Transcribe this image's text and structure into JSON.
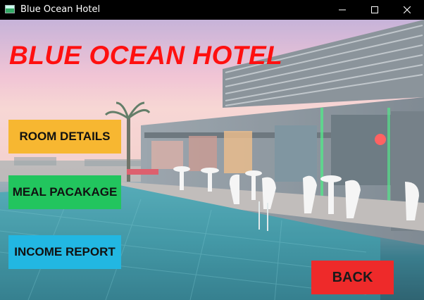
{
  "window": {
    "title": "Blue Ocean Hotel",
    "minimize_glyph": "—",
    "maximize_glyph": "☐",
    "close_glyph": "✕"
  },
  "header": {
    "title": "BLUE OCEAN HOTEL"
  },
  "menu": {
    "room_details": "ROOM DETAILS",
    "meal_package": "MEAL PACAKAGE",
    "income_report": "INCOME REPORT",
    "back": "BACK"
  },
  "colors": {
    "title": "#ff1010",
    "room_details": "#f7b731",
    "meal_package": "#22c55e",
    "income_report": "#22b7e2",
    "back": "#ee2a2a"
  },
  "icons": {
    "app": "app-window-icon",
    "minimize": "minimize-icon",
    "maximize": "maximize-icon",
    "close": "close-icon"
  }
}
